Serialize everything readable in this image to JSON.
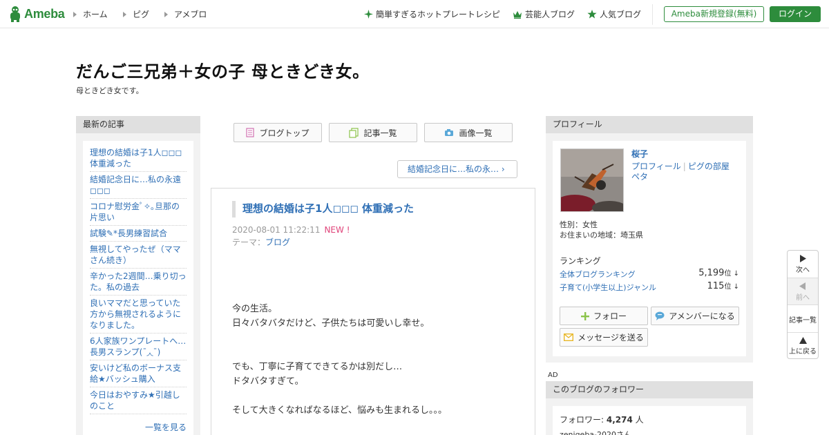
{
  "header": {
    "logo_text": "Ameba",
    "nav": [
      "ホーム",
      "ピグ",
      "アメブロ"
    ],
    "right_links": [
      "簡単すぎるホットプレートレシピ",
      "芸能人ブログ",
      "人気ブログ"
    ],
    "register_label": "Ameba新規登録(無料)",
    "login_label": "ログイン"
  },
  "blog": {
    "title": "だんご三兄弟＋女の子 母ときどき女。",
    "subtitle": "母ときどき女です。"
  },
  "sidebar_left": {
    "heading": "最新の記事",
    "articles": [
      "理想の結婚は子1人◻︎◻︎◻︎ 体重減った",
      "結婚記念日に…私の永遠◻︎◻︎◻︎",
      "コロナ慰労金ﾟ✧｡旦那の片思い",
      "試験✎*長男練習試合",
      "無視してやったぜ（ママさん続き）",
      "辛かった2週間…乗り切った。私の過去",
      "良いママだと思っていた方から無視されるようになりました。",
      "6人家族ワンプレートへ…長男スランプ(ˉ◞◟ˉ)",
      "安いけど私のボーナス支給★バッシュ購入",
      "今日はおやすみ★引越しのこと"
    ],
    "more_label": "一覧を見る"
  },
  "center": {
    "tabs": [
      "ブログトップ",
      "記事一覧",
      "画像一覧"
    ],
    "next_link": "結婚記念日に…私の永… ›",
    "entry": {
      "title": "理想の結婚は子1人◻︎◻︎◻︎ 体重減った",
      "date": "2020-08-01 11:22:11",
      "new_badge": "NEW !",
      "theme_label": "テーマ：",
      "theme_value": "ブログ",
      "body": [
        "今の生活。",
        "日々バタバタだけど、子供たちは可愛いし幸せ。",
        "",
        "",
        "でも、丁寧に子育てできてるかは別だし…",
        "ドタバタすぎて。",
        "",
        "そして大きくなればなるほど、悩みも生まれるし。。。"
      ]
    }
  },
  "sidebar_right": {
    "heading": "プロフィール",
    "name": "桜子",
    "link_profile": "プロフィール",
    "link_room": "ピグの部屋",
    "link_peta": "ペタ",
    "gender": "性別：女性",
    "location": "お住まいの地域：埼玉県",
    "ranking_heading": "ランキング",
    "ranking": [
      {
        "label": "全体ブログランキング",
        "value": "5,199",
        "unit": "位 ↓"
      },
      {
        "label": "子育て(小学生以上)ジャンル",
        "value": "115",
        "unit": "位 ↓"
      }
    ],
    "follow_label": "フォロー",
    "member_label": "アメンバーになる",
    "message_label": "メッセージを送る",
    "ad_label": "AD",
    "followers_heading": "このブログのフォロワー",
    "followers_prefix": "フォロワー: ",
    "followers_count": "4,274",
    "followers_suffix": " 人",
    "follower_name": "zenigeba-2020さん"
  },
  "float_nav": [
    "次へ",
    "前へ",
    "記事一覧",
    "上に戻る"
  ],
  "colors": {
    "brand": "#2d8c3c",
    "link": "#2f6fb5",
    "new": "#e0447a"
  }
}
